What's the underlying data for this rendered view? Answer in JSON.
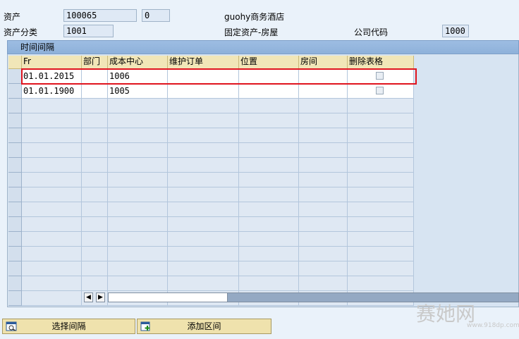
{
  "header": {
    "asset_label": "资产",
    "asset_number": "100065",
    "asset_subnumber": "0",
    "asset_description": "guohy商务酒店",
    "asset_class_label": "资产分类",
    "asset_class_value": "1001",
    "asset_class_desc": "固定资产-房屋",
    "company_code_label": "公司代码",
    "company_code_value": "1000"
  },
  "panel": {
    "title": "时间间隔"
  },
  "table": {
    "columns": [
      "Fr",
      "部门",
      "成本中心",
      "维护订单",
      "位置",
      "房间",
      "删除表格"
    ],
    "rows": [
      {
        "from": "01.01.2015",
        "dept": "",
        "cost_center": "1006",
        "maint_order": "",
        "location": "",
        "room": "",
        "delete": false
      },
      {
        "from": "01.01.1900",
        "dept": "",
        "cost_center": "1005",
        "maint_order": "",
        "location": "",
        "room": "",
        "delete": false
      }
    ],
    "empty_rows": 14
  },
  "buttons": {
    "select_interval": "选择间隔",
    "add_interval": "添加区间"
  },
  "watermark": {
    "text": "赛她网",
    "url": "www.918dp.com"
  },
  "colors": {
    "highlight": "#e0141e",
    "header_bg": "#f1e6b8",
    "panel_title_bg": "#9dbde2"
  },
  "icons": [
    "scroll-left-icon",
    "scroll-right-icon",
    "select-interval-icon",
    "add-interval-icon"
  ]
}
